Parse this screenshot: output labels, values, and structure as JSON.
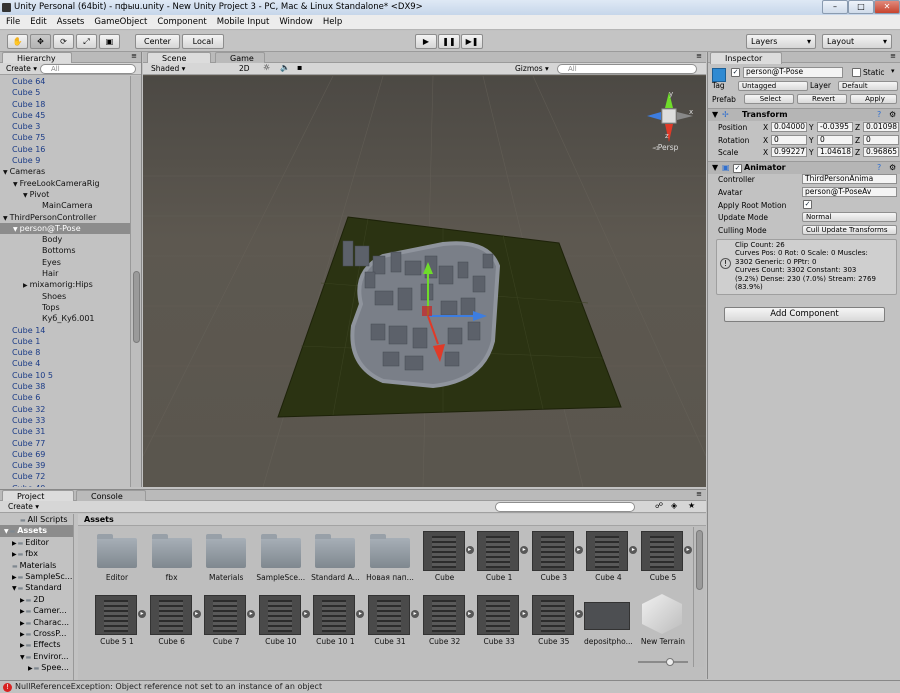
{
  "window": {
    "title": "Unity Personal (64bit) - пфыu.unity - New Unity Project 3 - PC, Mac & Linux Standalone* <DX9>"
  },
  "menu": [
    "File",
    "Edit",
    "Assets",
    "GameObject",
    "Component",
    "Mobile Input",
    "Window",
    "Help"
  ],
  "toolbar": {
    "pivot": "Center",
    "space": "Local",
    "layers": "Layers",
    "layout": "Layout"
  },
  "hierarchy": {
    "tab": "Hierarchy",
    "create": "Create",
    "search_placeholder": "All",
    "rows": [
      {
        "t": "Cube 64",
        "d": 0,
        "c": "blue"
      },
      {
        "t": "Cube 5",
        "d": 0,
        "c": "blue"
      },
      {
        "t": "Cube 18",
        "d": 0,
        "c": "blue"
      },
      {
        "t": "Cube 45",
        "d": 0,
        "c": "blue"
      },
      {
        "t": "Cube 3",
        "d": 0,
        "c": "blue"
      },
      {
        "t": "Cube 75",
        "d": 0,
        "c": "blue"
      },
      {
        "t": "Cube 16",
        "d": 0,
        "c": "blue"
      },
      {
        "t": "Cube 9",
        "d": 0,
        "c": "blue"
      },
      {
        "t": "Cameras",
        "d": 0,
        "c": "black",
        "a": "▼"
      },
      {
        "t": "FreeLookCameraRig",
        "d": 1,
        "c": "black",
        "a": "▼"
      },
      {
        "t": "Pivot",
        "d": 2,
        "c": "black",
        "a": "▼"
      },
      {
        "t": "MainCamera",
        "d": 3,
        "c": "black"
      },
      {
        "t": "ThirdPersonController",
        "d": 0,
        "c": "black",
        "a": "▼"
      },
      {
        "t": "person@T-Pose",
        "d": 1,
        "c": "sel",
        "a": "▼"
      },
      {
        "t": "Body",
        "d": 3,
        "c": "black"
      },
      {
        "t": "Bottoms",
        "d": 3,
        "c": "black"
      },
      {
        "t": "Eyes",
        "d": 3,
        "c": "black"
      },
      {
        "t": "Hair",
        "d": 3,
        "c": "black"
      },
      {
        "t": "mixamorig:Hips",
        "d": 2,
        "c": "black",
        "a": "▶"
      },
      {
        "t": "Shoes",
        "d": 3,
        "c": "black"
      },
      {
        "t": "Tops",
        "d": 3,
        "c": "black"
      },
      {
        "t": "Куб_Куб.001",
        "d": 3,
        "c": "black"
      },
      {
        "t": "Cube 14",
        "d": 0,
        "c": "blue"
      },
      {
        "t": "Cube 1",
        "d": 0,
        "c": "blue"
      },
      {
        "t": "Cube 8",
        "d": 0,
        "c": "blue"
      },
      {
        "t": "Cube 4",
        "d": 0,
        "c": "blue"
      },
      {
        "t": "Cube 10 5",
        "d": 0,
        "c": "blue"
      },
      {
        "t": "Cube 38",
        "d": 0,
        "c": "blue"
      },
      {
        "t": "Cube 6",
        "d": 0,
        "c": "blue"
      },
      {
        "t": "Cube 32",
        "d": 0,
        "c": "blue"
      },
      {
        "t": "Cube 33",
        "d": 0,
        "c": "blue"
      },
      {
        "t": "Cube 31",
        "d": 0,
        "c": "blue"
      },
      {
        "t": "Cube 77",
        "d": 0,
        "c": "blue"
      },
      {
        "t": "Cube 69",
        "d": 0,
        "c": "blue"
      },
      {
        "t": "Cube 39",
        "d": 0,
        "c": "blue"
      },
      {
        "t": "Cube 72",
        "d": 0,
        "c": "blue"
      },
      {
        "t": "Cube 40",
        "d": 0,
        "c": "blue"
      }
    ]
  },
  "scene": {
    "tab_scene": "Scene",
    "tab_game": "Game",
    "shading": "Shaded",
    "mode2d": "2D",
    "gizmos": "Gizmos",
    "search_placeholder": "All",
    "persp": "Persp",
    "gizmo_x": "x",
    "gizmo_y": "y",
    "gizmo_z": "z"
  },
  "inspector": {
    "tab": "Inspector",
    "object_name": "person@T-Pose",
    "static": "Static",
    "tag_label": "Tag",
    "tag_value": "Untagged",
    "layer_label": "Layer",
    "layer_value": "Default",
    "prefab_label": "Prefab",
    "select": "Select",
    "revert": "Revert",
    "apply": "Apply",
    "transform": {
      "title": "Transform",
      "position_label": "Position",
      "px": "0.04000",
      "py": "-0.0395",
      "pz": "0.01098",
      "rotation_label": "Rotation",
      "rx": "0",
      "ry": "0",
      "rz": "0",
      "scale_label": "Scale",
      "sx": "0.99227",
      "sy": "1.04618",
      "sz": "0.96865"
    },
    "animator": {
      "title": "Animator",
      "controller_label": "Controller",
      "controller_value": "ThirdPersonAnima",
      "avatar_label": "Avatar",
      "avatar_value": "person@T-PoseAv",
      "root_motion_label": "Apply Root Motion",
      "update_mode_label": "Update Mode",
      "update_mode_value": "Normal",
      "culling_mode_label": "Culling Mode",
      "culling_mode_value": "Cull Update Transforms",
      "info_lines": [
        "Clip Count: 26",
        "Curves Pos: 0 Rot: 0 Scale: 0 Muscles:",
        "3302 Generic: 0 PPtr: 0",
        "Curves Count: 3302 Constant: 303",
        "(9.2%) Dense: 230 (7.0%) Stream: 2769",
        "(83.9%)"
      ]
    },
    "add_component": "Add Component"
  },
  "project": {
    "tab_project": "Project",
    "tab_console": "Console",
    "create": "Create",
    "assets_header": "Assets",
    "tree": [
      {
        "t": "All Scripts",
        "d": 2
      },
      {
        "t": "Assets",
        "d": 0,
        "a": "▼",
        "b": true
      },
      {
        "t": "Editor",
        "d": 1,
        "a": "▶"
      },
      {
        "t": "fbx",
        "d": 1,
        "a": "▶"
      },
      {
        "t": "Materials",
        "d": 1
      },
      {
        "t": "SampleSc...",
        "d": 1,
        "a": "▶"
      },
      {
        "t": "Standard",
        "d": 1,
        "a": "▼"
      },
      {
        "t": "2D",
        "d": 2,
        "a": "▶"
      },
      {
        "t": "Camer...",
        "d": 2,
        "a": "▶"
      },
      {
        "t": "Charac...",
        "d": 2,
        "a": "▶"
      },
      {
        "t": "CrossP...",
        "d": 2,
        "a": "▶"
      },
      {
        "t": "Effects",
        "d": 2,
        "a": "▶"
      },
      {
        "t": "Enviror...",
        "d": 2,
        "a": "▼"
      },
      {
        "t": "Spee...",
        "d": 3,
        "a": "▶"
      }
    ],
    "assets_row1": [
      {
        "n": "Editor",
        "k": "folder"
      },
      {
        "n": "fbx",
        "k": "folder"
      },
      {
        "n": "Materials",
        "k": "folder"
      },
      {
        "n": "SampleSce...",
        "k": "folder"
      },
      {
        "n": "Standard A...",
        "k": "folder"
      },
      {
        "n": "Новая пап...",
        "k": "folder"
      },
      {
        "n": "Cube",
        "k": "cube"
      },
      {
        "n": "Cube 1",
        "k": "cube"
      },
      {
        "n": "Cube 3",
        "k": "cube"
      },
      {
        "n": "Cube 4",
        "k": "cube"
      },
      {
        "n": "Cube 5",
        "k": "cube"
      }
    ],
    "assets_row2": [
      {
        "n": "Cube 5 1",
        "k": "cube"
      },
      {
        "n": "Cube 6",
        "k": "cube"
      },
      {
        "n": "Cube 7",
        "k": "cube"
      },
      {
        "n": "Cube 10",
        "k": "cube"
      },
      {
        "n": "Cube 10 1",
        "k": "cube"
      },
      {
        "n": "Cube 31",
        "k": "cube"
      },
      {
        "n": "Cube 32",
        "k": "cube"
      },
      {
        "n": "Cube 33",
        "k": "cube"
      },
      {
        "n": "Cube 35",
        "k": "cube"
      },
      {
        "n": "depositpho...",
        "k": "flat"
      },
      {
        "n": "New Terrain",
        "k": "terrain"
      }
    ]
  },
  "status": {
    "error": "NullReferenceException: Object reference not set to an instance of an object"
  }
}
